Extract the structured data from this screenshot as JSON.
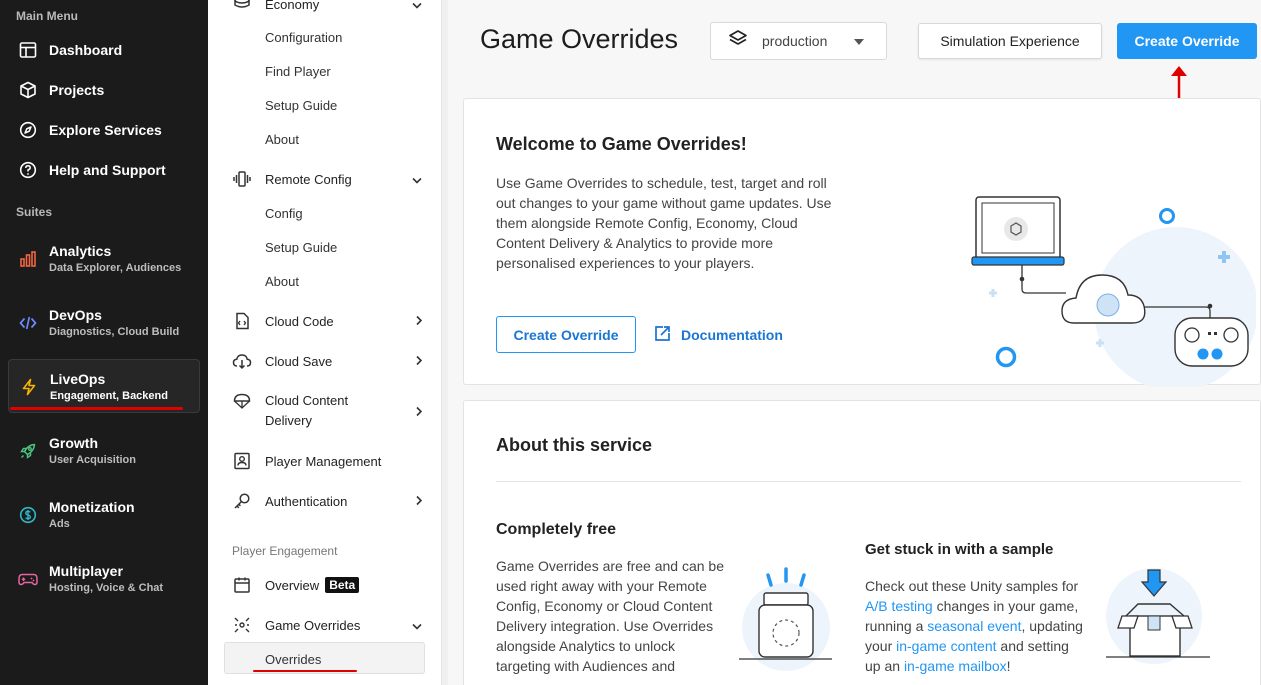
{
  "sidebar": {
    "main_menu_heading": "Main Menu",
    "items": [
      {
        "label": "Dashboard",
        "icon": "dashboard-icon"
      },
      {
        "label": "Projects",
        "icon": "cube-icon"
      },
      {
        "label": "Explore Services",
        "icon": "compass-icon"
      },
      {
        "label": "Help and Support",
        "icon": "help-icon"
      }
    ],
    "suites_heading": "Suites",
    "suites": [
      {
        "title": "Analytics",
        "subtitle": "Data Explorer, Audiences",
        "icon": "bar-chart-icon",
        "color": "#f06543"
      },
      {
        "title": "DevOps",
        "subtitle": "Diagnostics, Cloud Build",
        "icon": "code-icon",
        "color": "#6a8bff"
      },
      {
        "title": "LiveOps",
        "subtitle": "Engagement, Backend",
        "icon": "lightning-icon",
        "color": "#f5b400",
        "active": true
      },
      {
        "title": "Growth",
        "subtitle": "User Acquisition",
        "icon": "rocket-icon",
        "color": "#4cc37f"
      },
      {
        "title": "Monetization",
        "subtitle": "Ads",
        "icon": "dollar-icon",
        "color": "#2fb8c5"
      },
      {
        "title": "Multiplayer",
        "subtitle": "Hosting, Voice & Chat",
        "icon": "gamepad-icon",
        "color": "#e865a5"
      }
    ]
  },
  "subnav": {
    "economy": {
      "label": "Economy",
      "children": [
        "Configuration",
        "Find Player",
        "Setup Guide",
        "About"
      ]
    },
    "remote_config": {
      "label": "Remote Config",
      "children": [
        "Config",
        "Setup Guide",
        "About"
      ]
    },
    "cloud_code": "Cloud Code",
    "cloud_save": "Cloud Save",
    "cloud_content_line1": "Cloud Content",
    "cloud_content_line2": "Delivery",
    "player_management": "Player Management",
    "authentication": "Authentication",
    "group_label": "Player Engagement",
    "overview": "Overview",
    "overview_badge": "Beta",
    "game_overrides": "Game Overrides",
    "overrides": "Overrides"
  },
  "header": {
    "title": "Game Overrides",
    "environment": "production",
    "simulation_button": "Simulation Experience",
    "create_button": "Create Override"
  },
  "welcome": {
    "title": "Welcome to Game Overrides!",
    "text": "Use Game Overrides to schedule, test, target and roll out changes to your game without game updates. Use them alongside Remote Config, Economy, Cloud Content Delivery & Analytics to provide more personalised experiences to your players.",
    "create_button": "Create Override",
    "doc_link": "Documentation"
  },
  "about": {
    "title": "About this service",
    "free_title": "Completely free",
    "free_text": "Game Overrides are free and can be used right away with your Remote Config, Economy or Cloud Content Delivery integration. Use Overrides alongside Analytics to unlock targeting with Audiences and",
    "sample_title": "Get stuck in with a sample",
    "sample_text_1": "Check out these Unity samples for ",
    "sample_link_1": "A/B testing",
    "sample_text_2": " changes in your game, running a ",
    "sample_link_2": "seasonal event",
    "sample_text_3": ", updating your ",
    "sample_link_3": "in-game content",
    "sample_text_4": " and setting up an ",
    "sample_link_4": "in-game mailbox",
    "sample_text_5": "!"
  },
  "colors": {
    "accent": "#2196f3",
    "annotation": "#e00000",
    "sidebar_bg": "#1b1b1b"
  }
}
